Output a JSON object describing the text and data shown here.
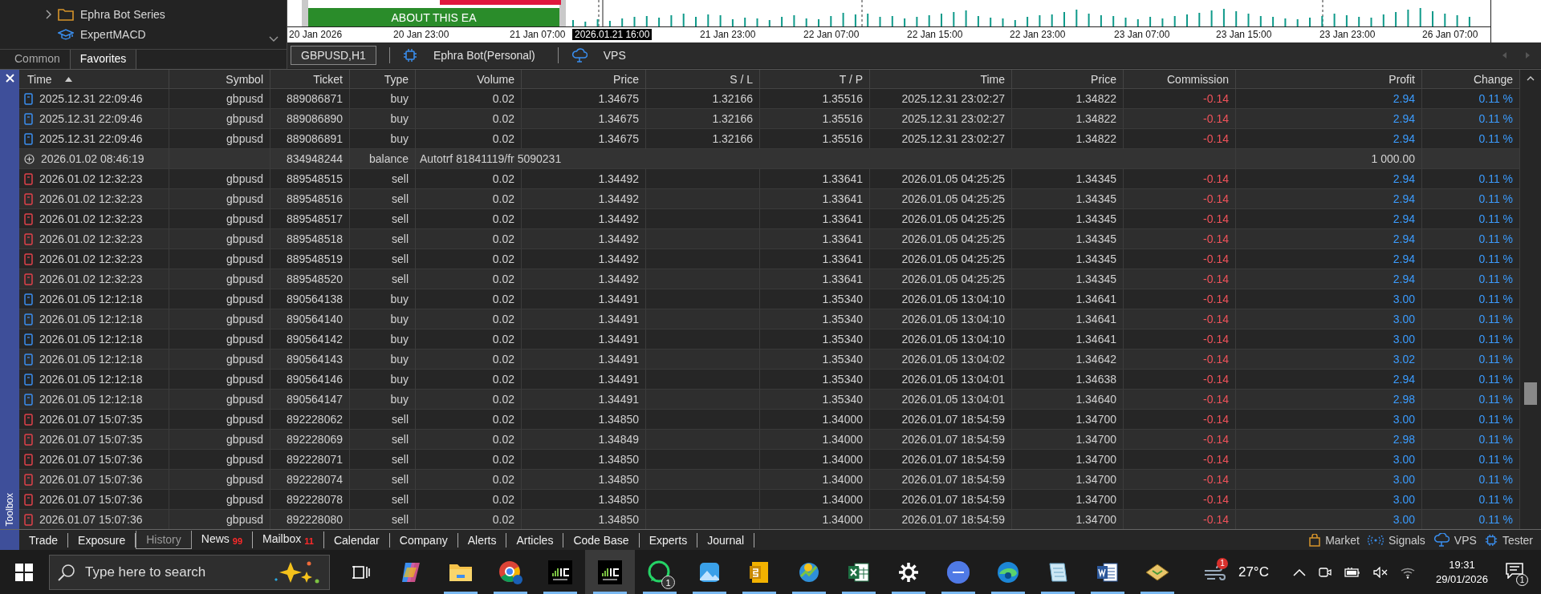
{
  "navigator": {
    "items": [
      {
        "label": "Ephra Bot Series",
        "kind": "folder"
      },
      {
        "label": "ExpertMACD",
        "kind": "expert"
      }
    ],
    "tabs": [
      {
        "label": "Common",
        "selected": false
      },
      {
        "label": "Favorites",
        "selected": true
      }
    ]
  },
  "chart": {
    "banner": "ABOUT THIS EA",
    "time_axis": [
      {
        "label": "20 Jan 2026",
        "selected": false
      },
      {
        "label": "20 Jan 23:00",
        "selected": false
      },
      {
        "label": "21 Jan 07:00",
        "selected": false
      },
      {
        "label": "2026.01.21 16:00",
        "selected": true
      },
      {
        "label": "21 Jan 23:00",
        "selected": false
      },
      {
        "label": "22 Jan 07:00",
        "selected": false
      },
      {
        "label": "22 Jan 15:00",
        "selected": false
      },
      {
        "label": "22 Jan 23:00",
        "selected": false
      },
      {
        "label": "23 Jan 07:00",
        "selected": false
      },
      {
        "label": "23 Jan 15:00",
        "selected": false
      },
      {
        "label": "23 Jan 23:00",
        "selected": false
      },
      {
        "label": "26 Jan 07:00",
        "selected": false
      }
    ]
  },
  "chart_tabs": [
    {
      "label": "GBPUSD,H1",
      "kind": "symbol",
      "selected": true
    },
    {
      "label": "Ephra Bot(Personal)",
      "kind": "expert",
      "selected": false
    },
    {
      "label": "VPS",
      "kind": "vps",
      "selected": false
    }
  ],
  "table": {
    "columns": [
      {
        "label": "Time",
        "sorted": true
      },
      {
        "label": "Symbol",
        "sorted": false
      },
      {
        "label": "Ticket",
        "sorted": false
      },
      {
        "label": "Type",
        "sorted": false
      },
      {
        "label": "Volume",
        "sorted": false
      },
      {
        "label": "Price",
        "sorted": false
      },
      {
        "label": "S / L",
        "sorted": false
      },
      {
        "label": "T / P",
        "sorted": false
      },
      {
        "label": "Time",
        "sorted": false
      },
      {
        "label": "Price",
        "sorted": false
      },
      {
        "label": "Commission",
        "sorted": false
      },
      {
        "label": "Profit",
        "sorted": false
      },
      {
        "label": "Change",
        "sorted": false
      }
    ],
    "rows": [
      {
        "kind": "buy",
        "time": "2025.12.31 22:09:46",
        "symbol": "gbpusd",
        "ticket": "889086871",
        "type": "buy",
        "volume": "0.02",
        "price": "1.34675",
        "sl": "1.32166",
        "tp": "1.35516",
        "close_time": "2025.12.31 23:02:27",
        "close_price": "1.34822",
        "commission": "-0.14",
        "profit": "2.94",
        "change": "0.11 %"
      },
      {
        "kind": "buy",
        "time": "2025.12.31 22:09:46",
        "symbol": "gbpusd",
        "ticket": "889086890",
        "type": "buy",
        "volume": "0.02",
        "price": "1.34675",
        "sl": "1.32166",
        "tp": "1.35516",
        "close_time": "2025.12.31 23:02:27",
        "close_price": "1.34822",
        "commission": "-0.14",
        "profit": "2.94",
        "change": "0.11 %"
      },
      {
        "kind": "buy",
        "time": "2025.12.31 22:09:46",
        "symbol": "gbpusd",
        "ticket": "889086891",
        "type": "buy",
        "volume": "0.02",
        "price": "1.34675",
        "sl": "1.32166",
        "tp": "1.35516",
        "close_time": "2025.12.31 23:02:27",
        "close_price": "1.34822",
        "commission": "-0.14",
        "profit": "2.94",
        "change": "0.11 %"
      },
      {
        "kind": "balance",
        "time": "2026.01.02 08:46:19",
        "ticket": "834948244",
        "type": "balance",
        "comment": "Autotrf 81841119/fr 5090231",
        "profit": "1 000.00"
      },
      {
        "kind": "sell",
        "time": "2026.01.02 12:32:23",
        "symbol": "gbpusd",
        "ticket": "889548515",
        "type": "sell",
        "volume": "0.02",
        "price": "1.34492",
        "tp": "1.33641",
        "close_time": "2026.01.05 04:25:25",
        "close_price": "1.34345",
        "commission": "-0.14",
        "profit": "2.94",
        "change": "0.11 %"
      },
      {
        "kind": "sell",
        "time": "2026.01.02 12:32:23",
        "symbol": "gbpusd",
        "ticket": "889548516",
        "type": "sell",
        "volume": "0.02",
        "price": "1.34492",
        "tp": "1.33641",
        "close_time": "2026.01.05 04:25:25",
        "close_price": "1.34345",
        "commission": "-0.14",
        "profit": "2.94",
        "change": "0.11 %"
      },
      {
        "kind": "sell",
        "time": "2026.01.02 12:32:23",
        "symbol": "gbpusd",
        "ticket": "889548517",
        "type": "sell",
        "volume": "0.02",
        "price": "1.34492",
        "tp": "1.33641",
        "close_time": "2026.01.05 04:25:25",
        "close_price": "1.34345",
        "commission": "-0.14",
        "profit": "2.94",
        "change": "0.11 %"
      },
      {
        "kind": "sell",
        "time": "2026.01.02 12:32:23",
        "symbol": "gbpusd",
        "ticket": "889548518",
        "type": "sell",
        "volume": "0.02",
        "price": "1.34492",
        "tp": "1.33641",
        "close_time": "2026.01.05 04:25:25",
        "close_price": "1.34345",
        "commission": "-0.14",
        "profit": "2.94",
        "change": "0.11 %"
      },
      {
        "kind": "sell",
        "time": "2026.01.02 12:32:23",
        "symbol": "gbpusd",
        "ticket": "889548519",
        "type": "sell",
        "volume": "0.02",
        "price": "1.34492",
        "tp": "1.33641",
        "close_time": "2026.01.05 04:25:25",
        "close_price": "1.34345",
        "commission": "-0.14",
        "profit": "2.94",
        "change": "0.11 %"
      },
      {
        "kind": "sell",
        "time": "2026.01.02 12:32:23",
        "symbol": "gbpusd",
        "ticket": "889548520",
        "type": "sell",
        "volume": "0.02",
        "price": "1.34492",
        "tp": "1.33641",
        "close_time": "2026.01.05 04:25:25",
        "close_price": "1.34345",
        "commission": "-0.14",
        "profit": "2.94",
        "change": "0.11 %"
      },
      {
        "kind": "buy",
        "time": "2026.01.05 12:12:18",
        "symbol": "gbpusd",
        "ticket": "890564138",
        "type": "buy",
        "volume": "0.02",
        "price": "1.34491",
        "tp": "1.35340",
        "close_time": "2026.01.05 13:04:10",
        "close_price": "1.34641",
        "commission": "-0.14",
        "profit": "3.00",
        "change": "0.11 %"
      },
      {
        "kind": "buy",
        "time": "2026.01.05 12:12:18",
        "symbol": "gbpusd",
        "ticket": "890564140",
        "type": "buy",
        "volume": "0.02",
        "price": "1.34491",
        "tp": "1.35340",
        "close_time": "2026.01.05 13:04:10",
        "close_price": "1.34641",
        "commission": "-0.14",
        "profit": "3.00",
        "change": "0.11 %"
      },
      {
        "kind": "buy",
        "time": "2026.01.05 12:12:18",
        "symbol": "gbpusd",
        "ticket": "890564142",
        "type": "buy",
        "volume": "0.02",
        "price": "1.34491",
        "tp": "1.35340",
        "close_time": "2026.01.05 13:04:10",
        "close_price": "1.34641",
        "commission": "-0.14",
        "profit": "3.00",
        "change": "0.11 %"
      },
      {
        "kind": "buy",
        "time": "2026.01.05 12:12:18",
        "symbol": "gbpusd",
        "ticket": "890564143",
        "type": "buy",
        "volume": "0.02",
        "price": "1.34491",
        "tp": "1.35340",
        "close_time": "2026.01.05 13:04:02",
        "close_price": "1.34642",
        "commission": "-0.14",
        "profit": "3.02",
        "change": "0.11 %"
      },
      {
        "kind": "buy",
        "time": "2026.01.05 12:12:18",
        "symbol": "gbpusd",
        "ticket": "890564146",
        "type": "buy",
        "volume": "0.02",
        "price": "1.34491",
        "tp": "1.35340",
        "close_time": "2026.01.05 13:04:01",
        "close_price": "1.34638",
        "commission": "-0.14",
        "profit": "2.94",
        "change": "0.11 %"
      },
      {
        "kind": "buy",
        "time": "2026.01.05 12:12:18",
        "symbol": "gbpusd",
        "ticket": "890564147",
        "type": "buy",
        "volume": "0.02",
        "price": "1.34491",
        "tp": "1.35340",
        "close_time": "2026.01.05 13:04:01",
        "close_price": "1.34640",
        "commission": "-0.14",
        "profit": "2.98",
        "change": "0.11 %"
      },
      {
        "kind": "sell",
        "time": "2026.01.07 15:07:35",
        "symbol": "gbpusd",
        "ticket": "892228062",
        "type": "sell",
        "volume": "0.02",
        "price": "1.34850",
        "tp": "1.34000",
        "close_time": "2026.01.07 18:54:59",
        "close_price": "1.34700",
        "commission": "-0.14",
        "profit": "3.00",
        "change": "0.11 %"
      },
      {
        "kind": "sell",
        "time": "2026.01.07 15:07:35",
        "symbol": "gbpusd",
        "ticket": "892228069",
        "type": "sell",
        "volume": "0.02",
        "price": "1.34849",
        "tp": "1.34000",
        "close_time": "2026.01.07 18:54:59",
        "close_price": "1.34700",
        "commission": "-0.14",
        "profit": "2.98",
        "change": "0.11 %"
      },
      {
        "kind": "sell",
        "time": "2026.01.07 15:07:36",
        "symbol": "gbpusd",
        "ticket": "892228071",
        "type": "sell",
        "volume": "0.02",
        "price": "1.34850",
        "tp": "1.34000",
        "close_time": "2026.01.07 18:54:59",
        "close_price": "1.34700",
        "commission": "-0.14",
        "profit": "3.00",
        "change": "0.11 %"
      },
      {
        "kind": "sell",
        "time": "2026.01.07 15:07:36",
        "symbol": "gbpusd",
        "ticket": "892228074",
        "type": "sell",
        "volume": "0.02",
        "price": "1.34850",
        "tp": "1.34000",
        "close_time": "2026.01.07 18:54:59",
        "close_price": "1.34700",
        "commission": "-0.14",
        "profit": "3.00",
        "change": "0.11 %"
      },
      {
        "kind": "sell",
        "time": "2026.01.07 15:07:36",
        "symbol": "gbpusd",
        "ticket": "892228078",
        "type": "sell",
        "volume": "0.02",
        "price": "1.34850",
        "tp": "1.34000",
        "close_time": "2026.01.07 18:54:59",
        "close_price": "1.34700",
        "commission": "-0.14",
        "profit": "3.00",
        "change": "0.11 %"
      },
      {
        "kind": "sell",
        "time": "2026.01.07 15:07:36",
        "symbol": "gbpusd",
        "ticket": "892228080",
        "type": "sell",
        "volume": "0.02",
        "price": "1.34850",
        "tp": "1.34000",
        "close_time": "2026.01.07 18:54:59",
        "close_price": "1.34700",
        "commission": "-0.14",
        "profit": "3.00",
        "change": "0.11 %"
      }
    ]
  },
  "toolbox": {
    "label": "Toolbox",
    "tabs": [
      {
        "label": "Trade",
        "selected": false
      },
      {
        "label": "Exposure",
        "selected": false
      },
      {
        "label": "History",
        "selected": true
      },
      {
        "label": "News",
        "badge": "99",
        "selected": false
      },
      {
        "label": "Mailbox",
        "badge": "11",
        "selected": false
      },
      {
        "label": "Calendar",
        "selected": false
      },
      {
        "label": "Company",
        "selected": false
      },
      {
        "label": "Alerts",
        "selected": false
      },
      {
        "label": "Articles",
        "selected": false
      },
      {
        "label": "Code Base",
        "selected": false
      },
      {
        "label": "Experts",
        "selected": false
      },
      {
        "label": "Journal",
        "selected": false
      }
    ],
    "services": [
      {
        "label": "Market",
        "kind": "market"
      },
      {
        "label": "Signals",
        "kind": "signals"
      },
      {
        "label": "VPS",
        "kind": "vps"
      },
      {
        "label": "Tester",
        "kind": "tester"
      }
    ]
  },
  "taskbar": {
    "search": {
      "placeholder": "Type here to search"
    },
    "apps": [
      {
        "kind": "taskview",
        "open": false,
        "active": false
      },
      {
        "kind": "copilot",
        "open": false,
        "active": false
      },
      {
        "kind": "explorer",
        "open": true,
        "active": false
      },
      {
        "kind": "chrome",
        "open": true,
        "active": false
      },
      {
        "kind": "terminal",
        "open": true,
        "active": false
      },
      {
        "kind": "terminal",
        "open": true,
        "active": true
      },
      {
        "kind": "whatsapp",
        "open": true,
        "active": false,
        "badge": "1"
      },
      {
        "kind": "photos",
        "open": true,
        "active": false
      },
      {
        "kind": "slides",
        "open": true,
        "active": false
      },
      {
        "kind": "mt5",
        "open": true,
        "active": false
      },
      {
        "kind": "excel",
        "open": true,
        "active": false
      },
      {
        "kind": "settings",
        "open": true,
        "active": false
      },
      {
        "kind": "canva",
        "open": true,
        "active": false
      },
      {
        "kind": "edge",
        "open": true,
        "active": false
      },
      {
        "kind": "notepad",
        "open": true,
        "active": false
      },
      {
        "kind": "word",
        "open": true,
        "active": false
      },
      {
        "kind": "archive",
        "open": true,
        "active": false
      }
    ],
    "weather": {
      "badge": "1",
      "temperature": "27°C"
    },
    "clock": {
      "time": "19:31",
      "date": "29/01/2026"
    },
    "notifications": "1"
  }
}
